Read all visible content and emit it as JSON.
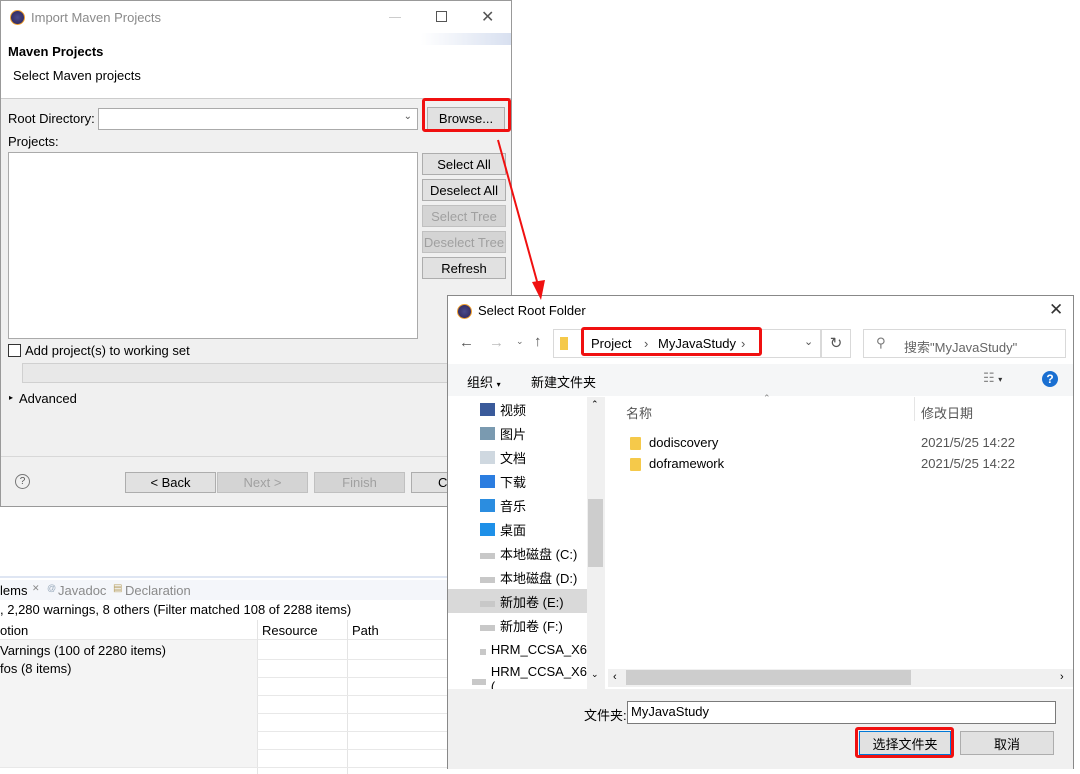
{
  "maven_dialog": {
    "title": "Import Maven Projects",
    "header_title": "Maven Projects",
    "header_subtitle": "Select Maven projects",
    "root_directory_label": "Root Directory:",
    "root_directory_value": "",
    "browse_label": "Browse...",
    "projects_label": "Projects:",
    "side_buttons": [
      {
        "label": "Select All",
        "enabled": true
      },
      {
        "label": "Deselect All",
        "enabled": true
      },
      {
        "label": "Select Tree",
        "enabled": false
      },
      {
        "label": "Deselect Tree",
        "enabled": false
      },
      {
        "label": "Refresh",
        "enabled": true
      }
    ],
    "working_set_label": "Add project(s) to working set",
    "advanced_label": "Advanced",
    "footer_buttons": [
      {
        "label": "< Back",
        "enabled": true
      },
      {
        "label": "Next >",
        "enabled": false
      },
      {
        "label": "Finish",
        "enabled": false
      },
      {
        "label": "Ca",
        "enabled": true
      }
    ]
  },
  "problems_view": {
    "tabs": [
      "lems",
      "Javadoc",
      "Declaration"
    ],
    "status": ", 2,280 warnings, 8 others (Filter matched 108 of 2288 items)",
    "columns": [
      "otion",
      "Resource",
      "Path"
    ],
    "rows": [
      "Varnings (100 of 2280 items)",
      "fos (8 items)"
    ]
  },
  "folder_dialog": {
    "title": "Select Root Folder",
    "breadcrumb": [
      "Project",
      "MyJavaStudy"
    ],
    "search_placeholder": "搜索\"MyJavaStudy\"",
    "toolbar": {
      "organize": "组织",
      "new_folder": "新建文件夹"
    },
    "nav_items": [
      {
        "label": "视频",
        "icon": "video-icon"
      },
      {
        "label": "图片",
        "icon": "pictures-icon"
      },
      {
        "label": "文档",
        "icon": "documents-icon"
      },
      {
        "label": "下载",
        "icon": "download-icon"
      },
      {
        "label": "音乐",
        "icon": "music-icon"
      },
      {
        "label": "桌面",
        "icon": "desktop-icon"
      },
      {
        "label": "本地磁盘 (C:)",
        "icon": "drive-icon"
      },
      {
        "label": "本地磁盘 (D:)",
        "icon": "drive-icon"
      },
      {
        "label": "新加卷 (E:)",
        "icon": "drive-icon",
        "selected": true
      },
      {
        "label": "新加卷 (F:)",
        "icon": "drive-icon"
      },
      {
        "label": "HRM_CCSA_X6",
        "icon": "drive-icon"
      },
      {
        "label": "HRM_CCSA_X6 (",
        "icon": "drive-icon"
      }
    ],
    "columns": [
      "名称",
      "修改日期"
    ],
    "files": [
      {
        "name": "dodiscovery",
        "modified": "2021/5/25 14:22"
      },
      {
        "name": "doframework",
        "modified": "2021/5/25 14:22"
      }
    ],
    "folder_label": "文件夹:",
    "folder_value": "MyJavaStudy",
    "select_button": "选择文件夹",
    "cancel_button": "取消"
  },
  "colors": {
    "annotation": "#f01010",
    "dialog_bg": "#f0f0f0",
    "selected": "#d9d9d9",
    "help": "#1a6fd1"
  }
}
